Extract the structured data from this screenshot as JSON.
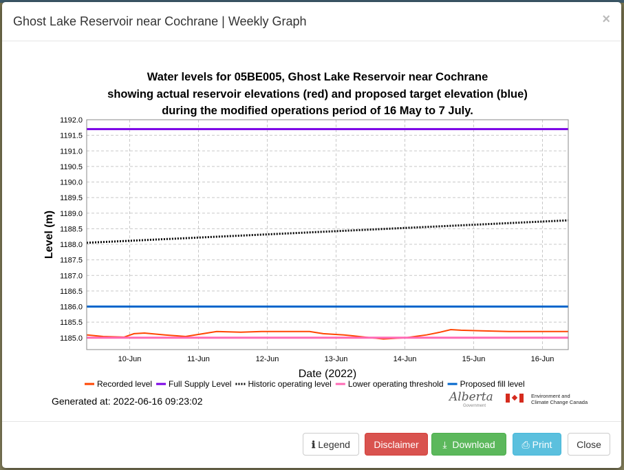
{
  "modal": {
    "title": "Ghost Lake Reservoir near Cochrane | Weekly Graph",
    "close_symbol": "×",
    "generated": "Generated at: 2022-06-16 09:23:02",
    "logos": {
      "alberta": "Alberta",
      "alberta_sub": "Government",
      "eccc_line1": "Environment and",
      "eccc_line2": "Climate Change Canada"
    },
    "buttons": [
      {
        "label": "Legend",
        "icon": "info-icon",
        "symbol": "ℹ"
      },
      {
        "label": "Disclaimer"
      },
      {
        "label": "Download",
        "icon": "download-icon",
        "symbol": "⤓"
      },
      {
        "label": "Print",
        "icon": "print-icon",
        "symbol": "⎙"
      },
      {
        "label": "Close"
      }
    ]
  },
  "chart_data": {
    "type": "line",
    "title_lines": [
      "Water levels for 05BE005, Ghost Lake Reservoir near Cochrane",
      "showing actual reservoir elevations (red) and proposed target elevation (blue)",
      "during the modified operations period of 16 May to 7 July."
    ],
    "xlabel": "Date (2022)",
    "ylabel": "Level (m)",
    "xlim": [
      "2022-06-09T09:00",
      "2022-06-16T09:00"
    ],
    "ylim": [
      1184.62,
      1192.0
    ],
    "x_ticks": [
      "10-Jun",
      "11-Jun",
      "12-Jun",
      "13-Jun",
      "14-Jun",
      "15-Jun",
      "16-Jun"
    ],
    "x_tick_dates": [
      "2022-06-10",
      "2022-06-11",
      "2022-06-12",
      "2022-06-13",
      "2022-06-14",
      "2022-06-15",
      "2022-06-16"
    ],
    "y_ticks": [
      "1185.0",
      "1185.5",
      "1186.0",
      "1186.5",
      "1187.0",
      "1187.5",
      "1188.0",
      "1188.5",
      "1189.0",
      "1189.5",
      "1190.0",
      "1190.5",
      "1191.0",
      "1191.5",
      "1192.0"
    ],
    "grid": true,
    "legend_position": "bottom",
    "series": [
      {
        "name": "Recorded level",
        "color": "#ff4500",
        "style": "solid",
        "points": [
          [
            "2022-06-09T09:00",
            1185.09
          ],
          [
            "2022-06-09T14:45",
            1185.04
          ],
          [
            "2022-06-09T22:00",
            1185.02
          ],
          [
            "2022-06-10T01:30",
            1185.13
          ],
          [
            "2022-06-10T05:10",
            1185.15
          ],
          [
            "2022-06-10T12:20",
            1185.09
          ],
          [
            "2022-06-10T19:30",
            1185.04
          ],
          [
            "2022-06-11T00:20",
            1185.11
          ],
          [
            "2022-06-11T06:20",
            1185.2
          ],
          [
            "2022-06-11T14:45",
            1185.18
          ],
          [
            "2022-06-11T22:00",
            1185.2
          ],
          [
            "2022-06-12T14:45",
            1185.2
          ],
          [
            "2022-06-12T19:30",
            1185.13
          ],
          [
            "2022-06-13T02:45",
            1185.09
          ],
          [
            "2022-06-13T10:00",
            1185.02
          ],
          [
            "2022-06-13T16:30",
            1184.96
          ],
          [
            "2022-06-14T00:20",
            1185.0
          ],
          [
            "2022-06-14T07:35",
            1185.09
          ],
          [
            "2022-06-14T12:20",
            1185.18
          ],
          [
            "2022-06-14T16:00",
            1185.26
          ],
          [
            "2022-06-14T19:35",
            1185.24
          ],
          [
            "2022-06-15T02:45",
            1185.22
          ],
          [
            "2022-06-15T12:20",
            1185.2
          ],
          [
            "2022-06-16T00:20",
            1185.2
          ],
          [
            "2022-06-16T09:00",
            1185.2
          ]
        ]
      },
      {
        "name": "Full Supply Level",
        "color": "#7a00e6",
        "style": "solid",
        "points": [
          [
            "2022-06-09T09:00",
            1191.7
          ],
          [
            "2022-06-16T09:00",
            1191.7
          ]
        ]
      },
      {
        "name": "Historic operating level",
        "color": "#000000",
        "style": "dotted",
        "points": [
          [
            "2022-06-09T09:00",
            1188.05
          ],
          [
            "2022-06-16T09:00",
            1188.77
          ]
        ]
      },
      {
        "name": "Lower operating threshold",
        "color": "#ff69b4",
        "style": "solid",
        "points": [
          [
            "2022-06-09T09:00",
            1185.0
          ],
          [
            "2022-06-16T09:00",
            1185.0
          ]
        ]
      },
      {
        "name": "Proposed fill level",
        "color": "#0066cc",
        "style": "solid",
        "points": [
          [
            "2022-06-09T09:00",
            1186.0
          ],
          [
            "2022-06-16T09:00",
            1186.0
          ]
        ]
      }
    ]
  }
}
